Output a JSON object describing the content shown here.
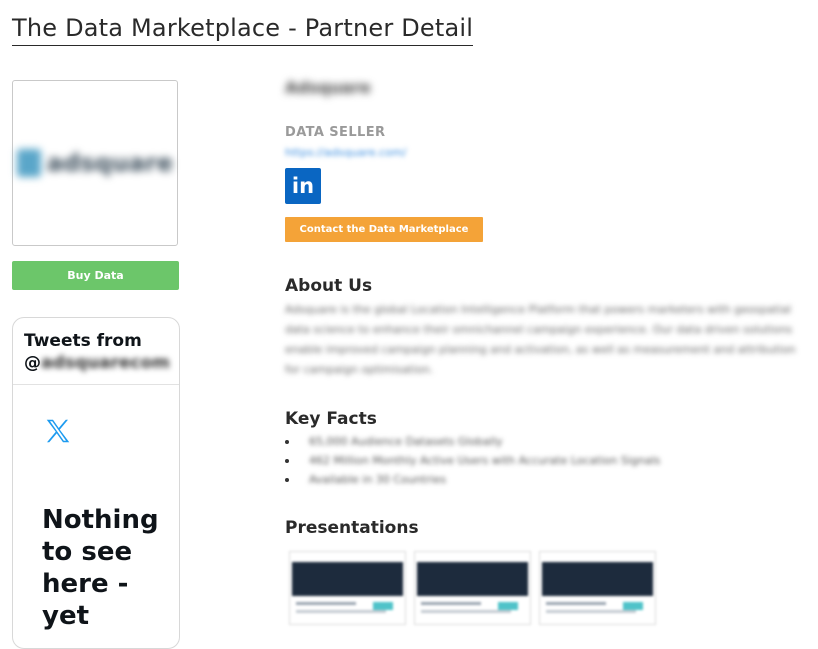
{
  "page": {
    "title": "The Data Marketplace - Partner Detail"
  },
  "partner": {
    "logo_text": "adsquare",
    "name": "Adsquare",
    "type": "DATA SELLER",
    "website": "https://adsquare.com/",
    "linkedin_label": "in"
  },
  "actions": {
    "buy_label": "Buy Data",
    "contact_label": "Contact the Data Marketplace"
  },
  "tweets": {
    "heading": "Tweets from",
    "handle_prefix": "@",
    "handle": "adsquarecom",
    "empty_message": "Nothing to see here - yet"
  },
  "about": {
    "heading": "About Us",
    "text": "Adsquare is the global Location Intelligence Platform that powers marketers with geospatial data science to enhance their omnichannel campaign experience. Our data driven solutions enable improved campaign planning and activation, as well as measurement and attribution for campaign optimisation."
  },
  "key_facts": {
    "heading": "Key Facts",
    "items": [
      "65,000 Audience Datasets Globally",
      "462 Million Monthly Active Users with Accurate Location Signals",
      "Available in 30 Countries"
    ]
  },
  "presentations": {
    "heading": "Presentations"
  },
  "colors": {
    "buy_button": "#6cc66a",
    "contact_button": "#f4a338",
    "linkedin": "#0a66c2",
    "link": "#3d8fe0",
    "x_logo": "#1d9bf0"
  }
}
